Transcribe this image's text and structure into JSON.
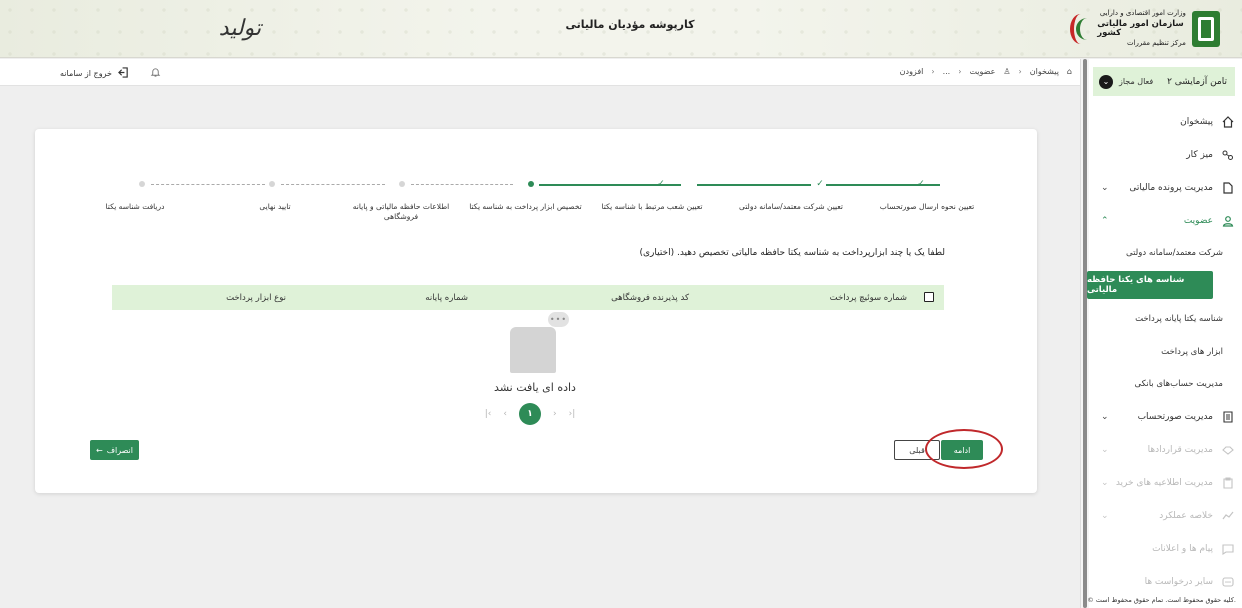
{
  "header": {
    "app_title": "کارپوشه مؤدیان مالیاتی",
    "logo_org_line1": "وزارت امور اقتصادی و دارایی",
    "logo_org_line2": "سازمان امور مالیاتی کشور",
    "logo_org_line3": "مرکز تنظیم مقررات",
    "logo_left_text": "تولید"
  },
  "topnav": {
    "logout_label": "خروج از سامانه",
    "breadcrumb": [
      "پیشخوان",
      "عضویت",
      "...",
      "افزودن"
    ]
  },
  "sidebar": {
    "user_name": "تامن آزمایشی ۲",
    "user_role": "فعال مجاز",
    "items": [
      {
        "label": "پیشخوان",
        "icon": "home-icon"
      },
      {
        "label": "میز کار",
        "icon": "share-icon"
      },
      {
        "label": "مدیریت پرونده مالیاتی",
        "icon": "file-icon"
      },
      {
        "label": "عضویت",
        "icon": "user-icon"
      },
      {
        "label": "مدیریت صورتحساب",
        "icon": "receipt-icon"
      },
      {
        "label": "مدیریت قراردادها",
        "icon": "handshake-icon"
      },
      {
        "label": "مدیریت اطلاعیه های خرید",
        "icon": "clipboard-icon"
      },
      {
        "label": "خلاصه عملکرد",
        "icon": "chart-icon"
      },
      {
        "label": "پیام ها و اعلانات",
        "icon": "message-icon"
      },
      {
        "label": "سایر درخواست ها",
        "icon": "more-icon"
      }
    ],
    "sub_items": [
      "شرکت معتمد/سامانه دولتی",
      "شناسه های یکتا حافظه مالیاتی",
      "شناسه یکتا پایانه پرداخت",
      "ابزار های پرداخت",
      "مدیریت حساب‌های بانکی"
    ],
    "copyright": "© کلیه حقوق محفوظ است. تمام حقوق محفوظ است."
  },
  "steps": [
    {
      "label": "تعیین نحوه ارسال صورتحساب",
      "state": "done"
    },
    {
      "label": "تعیین شرکت معتمد/سامانه دولتی",
      "state": "done"
    },
    {
      "label": "تعیین شعب مرتبط با شناسه یکتا",
      "state": "done"
    },
    {
      "label": "تخصیص ابزار پرداخت به شناسه یکتا",
      "state": "current"
    },
    {
      "label": "اطلاعات حافظه مالیاتی و پایانه فروشگاهی",
      "state": "todo"
    },
    {
      "label": "تایید نهایی",
      "state": "todo"
    },
    {
      "label": "دریافت شناسه یکتا",
      "state": "todo"
    }
  ],
  "content": {
    "prompt": "لطفا یک یا چند ابزارپرداخت به شناسه یکتا حافظه مالیاتی تخصیص دهید. (اختیاری)",
    "columns": [
      "شماره سوئیچ پرداخت",
      "کد پذیرنده فروشگاهی",
      "شماره پایانه",
      "نوع ابزار پرداخت"
    ],
    "empty_text": "داده ای یافت نشد",
    "current_page": "۱"
  },
  "buttons": {
    "cancel": "انصراف",
    "prev": "قبلی",
    "next": "ادامه"
  },
  "colors": {
    "primary": "#2e8b57",
    "table_header": "#dff2d8",
    "highlight_circle": "#c0282b"
  }
}
